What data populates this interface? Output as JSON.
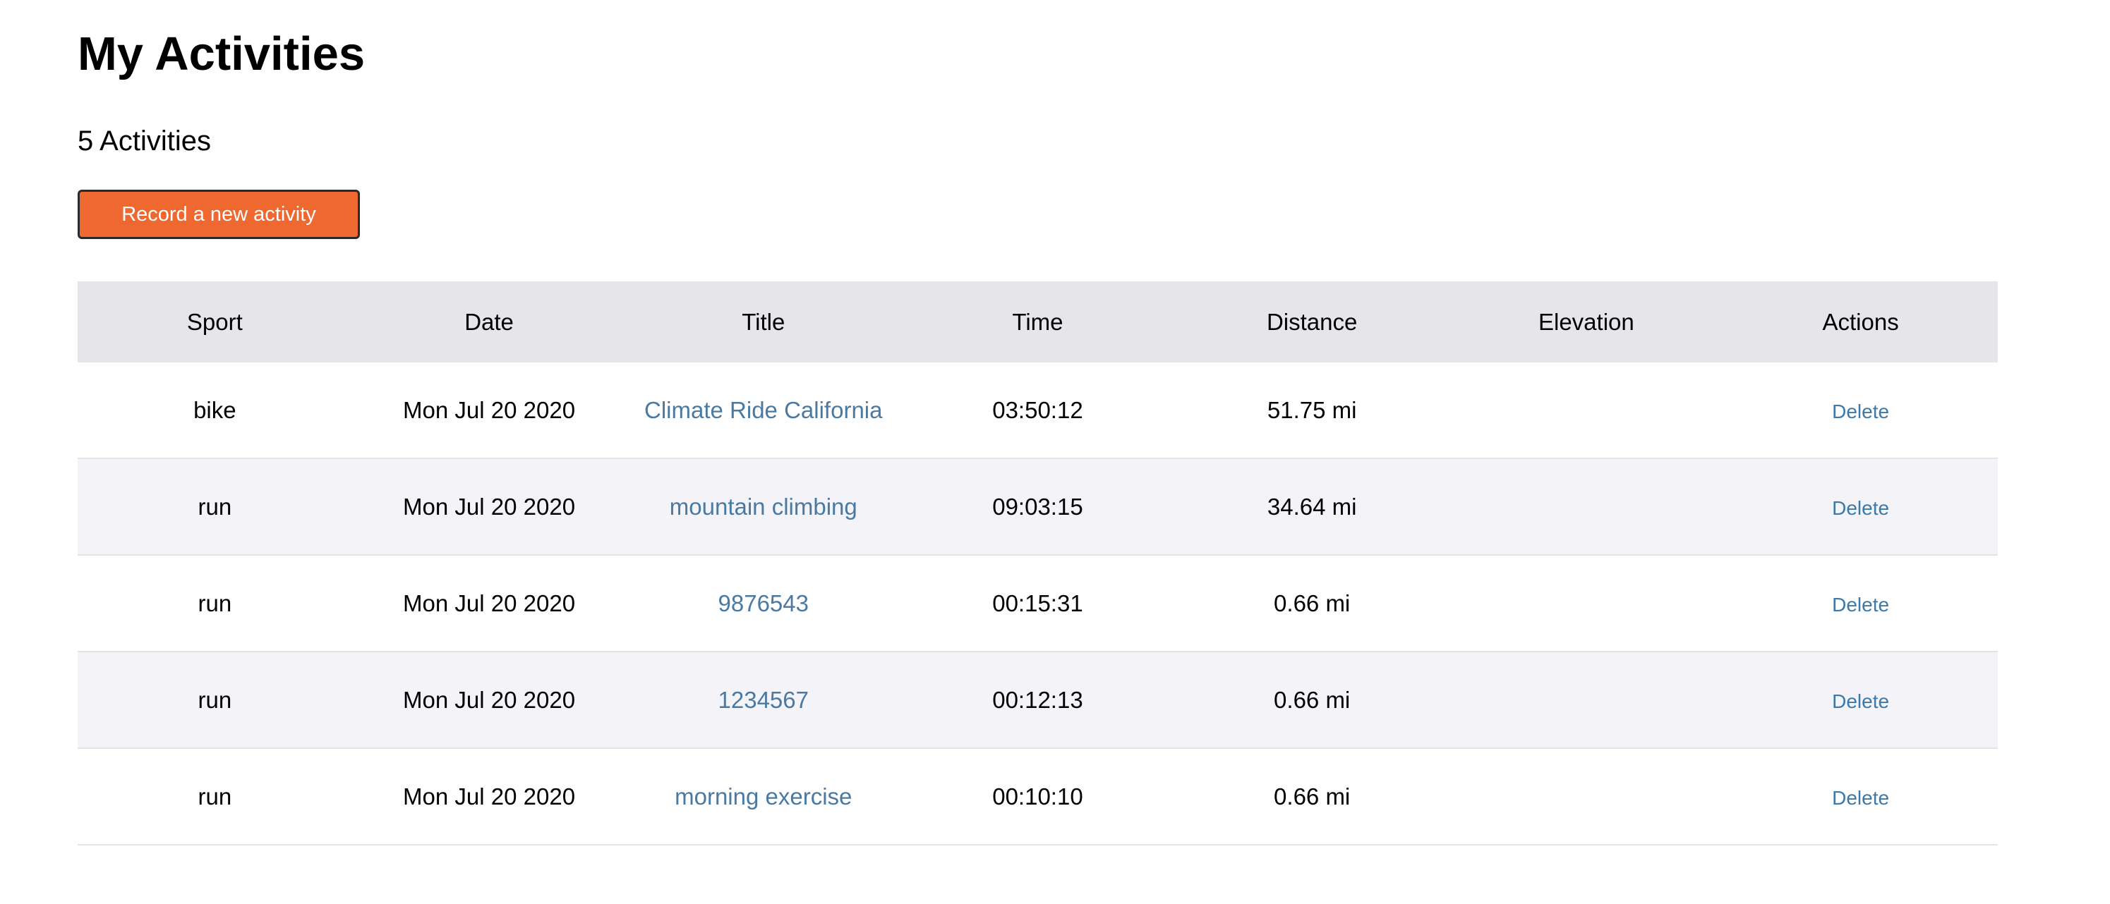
{
  "page": {
    "title": "My Activities",
    "count_text": "5 Activities",
    "record_button_label": "Record a new activity"
  },
  "colors": {
    "accent": "#ef6830",
    "link": "#4a7aa1",
    "header_bg": "#e6e6ea",
    "alt_row_bg": "#f4f4f8"
  },
  "table": {
    "headers": [
      "Sport",
      "Date",
      "Title",
      "Time",
      "Distance",
      "Elevation",
      "Actions"
    ],
    "rows": [
      {
        "sport": "bike",
        "date": "Mon Jul 20 2020",
        "title": "Climate Ride California",
        "time": "03:50:12",
        "distance": "51.75 mi",
        "elevation": "",
        "action": "Delete"
      },
      {
        "sport": "run",
        "date": "Mon Jul 20 2020",
        "title": "mountain climbing",
        "time": "09:03:15",
        "distance": "34.64 mi",
        "elevation": "",
        "action": "Delete"
      },
      {
        "sport": "run",
        "date": "Mon Jul 20 2020",
        "title": "9876543",
        "time": "00:15:31",
        "distance": "0.66 mi",
        "elevation": "",
        "action": "Delete"
      },
      {
        "sport": "run",
        "date": "Mon Jul 20 2020",
        "title": "1234567",
        "time": "00:12:13",
        "distance": "0.66 mi",
        "elevation": "",
        "action": "Delete"
      },
      {
        "sport": "run",
        "date": "Mon Jul 20 2020",
        "title": "morning exercise",
        "time": "00:10:10",
        "distance": "0.66 mi",
        "elevation": "",
        "action": "Delete"
      }
    ]
  }
}
